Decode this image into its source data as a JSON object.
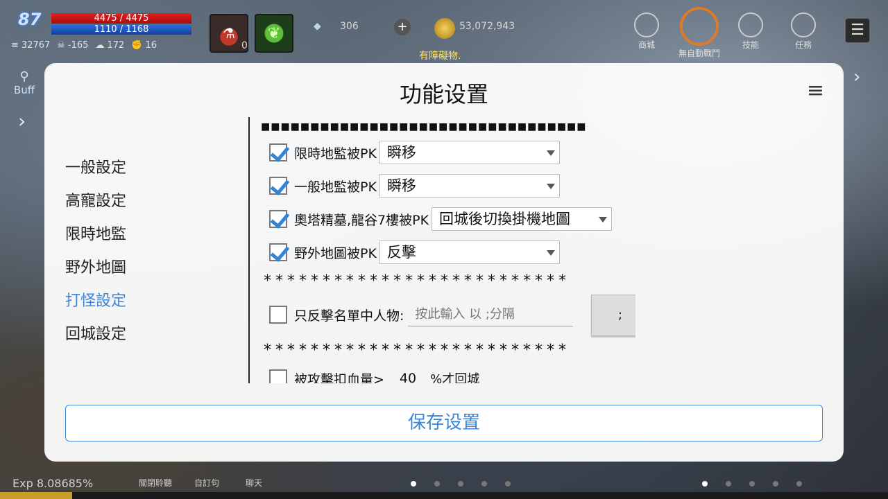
{
  "hud": {
    "level": "87",
    "hp": "4475 / 4475",
    "mp": "1110 / 1168",
    "stats": [
      "32767",
      "-165",
      "172",
      "16"
    ],
    "potion_count": "0",
    "gem_count": "306",
    "gold": "53,072,943",
    "notice": "有障礙物.",
    "buttons": {
      "store": "商城",
      "auto": "無自動戰鬥",
      "skill": "技能",
      "quest": "任務"
    },
    "buff_label": "Buff",
    "exp": "Exp 8.08685%",
    "exp_fraction": 0.0809,
    "bottom_labels": [
      "關閉聆聽",
      "自訂句",
      "聊天"
    ]
  },
  "modal": {
    "title": "功能设置",
    "nav": [
      "一般設定",
      "高寵設定",
      "限時地監",
      "野外地圖",
      "打怪設定",
      "回城設定"
    ],
    "active_nav": "打怪設定",
    "separator_squares": "■■■■■■■■■■■■■■■■■■■■■■■■■■■■■■■■■",
    "pk_rows": [
      {
        "label": "限時地監被PK",
        "checked": true,
        "value": "瞬移"
      },
      {
        "label": "一般地監被PK",
        "checked": true,
        "value": "瞬移"
      },
      {
        "label": "奧塔精墓,龍谷7樓被PK",
        "checked": true,
        "value": "回城後切換掛機地圖"
      },
      {
        "label": "野外地圖被PK",
        "checked": true,
        "value": "反擊"
      }
    ],
    "star_separator": "**************************",
    "counter_list": {
      "label": "只反擊名單中人物:",
      "checked": false,
      "placeholder": "按此輸入 以 ;分隔",
      "button": ";"
    },
    "hp_return": {
      "label": "被攻擊扣血量>",
      "checked": false,
      "value": "40",
      "suffix": "%才回城"
    },
    "save_label": "保存设置"
  },
  "colors": {
    "accent": "#3c86d8",
    "checkbox": "#2d86d6"
  }
}
